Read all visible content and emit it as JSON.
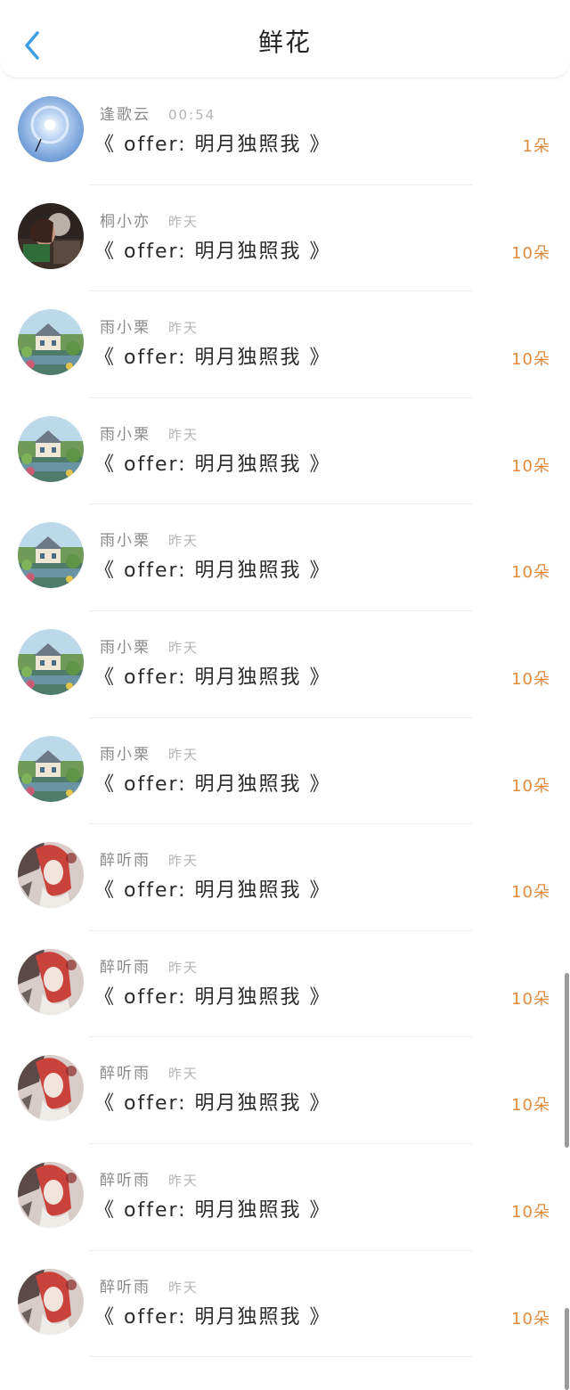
{
  "header": {
    "title": "鲜花"
  },
  "items": [
    {
      "sender": "逢歌云",
      "time": "00:54",
      "book": "《 offer: 明月独照我 》",
      "count": "1朵",
      "avatar": "halo-sky-avatar"
    },
    {
      "sender": "桐小亦",
      "time": "昨天",
      "book": "《 offer: 明月独照我 》",
      "count": "10朵",
      "avatar": "couple-portrait-avatar"
    },
    {
      "sender": "雨小栗",
      "time": "昨天",
      "book": "《 offer: 明月独照我 》",
      "count": "10朵",
      "avatar": "cottage-garden-avatar"
    },
    {
      "sender": "雨小栗",
      "time": "昨天",
      "book": "《 offer: 明月独照我 》",
      "count": "10朵",
      "avatar": "cottage-garden-avatar"
    },
    {
      "sender": "雨小栗",
      "time": "昨天",
      "book": "《 offer: 明月独照我 》",
      "count": "10朵",
      "avatar": "cottage-garden-avatar"
    },
    {
      "sender": "雨小栗",
      "time": "昨天",
      "book": "《 offer: 明月独照我 》",
      "count": "10朵",
      "avatar": "cottage-garden-avatar"
    },
    {
      "sender": "雨小栗",
      "time": "昨天",
      "book": "《 offer: 明月独照我 》",
      "count": "10朵",
      "avatar": "cottage-garden-avatar"
    },
    {
      "sender": "醉听雨",
      "time": "昨天",
      "book": "《 offer: 明月独照我 》",
      "count": "10朵",
      "avatar": "red-hair-girl-avatar"
    },
    {
      "sender": "醉听雨",
      "time": "昨天",
      "book": "《 offer: 明月独照我 》",
      "count": "10朵",
      "avatar": "red-hair-girl-avatar"
    },
    {
      "sender": "醉听雨",
      "time": "昨天",
      "book": "《 offer: 明月独照我 》",
      "count": "10朵",
      "avatar": "red-hair-girl-avatar"
    },
    {
      "sender": "醉听雨",
      "time": "昨天",
      "book": "《 offer: 明月独照我 》",
      "count": "10朵",
      "avatar": "red-hair-girl-avatar"
    },
    {
      "sender": "醉听雨",
      "time": "昨天",
      "book": "《 offer: 明月独照我 》",
      "count": "10朵",
      "avatar": "red-hair-girl-avatar"
    }
  ],
  "colors": {
    "accent_blue": "#3a9ee6",
    "count_orange": "#e08a3c",
    "sender_gray": "#8a8a8a",
    "time_gray": "#b5b5b5",
    "title_text": "#222222"
  }
}
